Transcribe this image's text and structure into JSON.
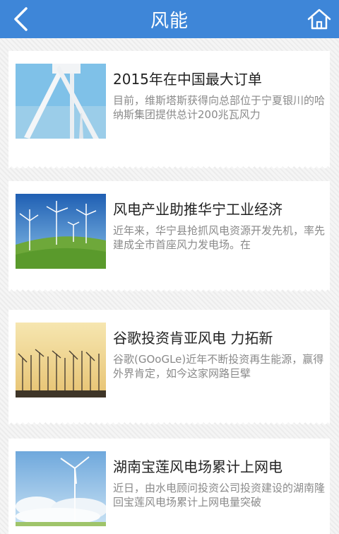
{
  "header": {
    "title": "风能",
    "back_icon": "chevron-left-icon",
    "home_icon": "home-icon",
    "bg_color": "#3e86d8"
  },
  "articles": [
    {
      "title": "2015年在中国最大订单",
      "summary": "目前，维斯塔斯获得向总部位于宁夏银川的哈纳斯集团提供总计200兆瓦风力"
    },
    {
      "title": "风电产业助推华宁工业经济",
      "summary": "近年来，华宁县抢抓风电资源开发先机，率先建成全市首座风力发电场。在"
    },
    {
      "title": "谷歌投资肯亚风电 力拓新",
      "summary": "谷歌(GOoGLe)近年不断投资再生能源，赢得外界肯定，如今这家网路巨擘"
    },
    {
      "title": "湖南宝莲风电场累计上网电",
      "summary": "近日，由水电顾问投资公司投资建设的湖南隆回宝莲风电场累计上网电量突破"
    }
  ]
}
